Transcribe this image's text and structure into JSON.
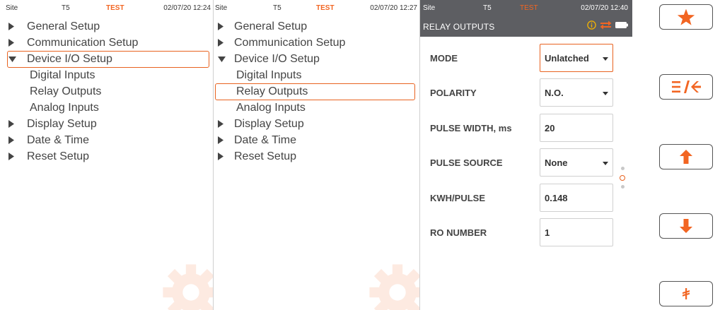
{
  "panel1": {
    "status": {
      "site": "Site",
      "meter": "T5",
      "mode": "TEST",
      "datetime": "02/07/20 12:24"
    },
    "menu": [
      {
        "label": "General Setup",
        "type": "collapsed"
      },
      {
        "label": "Communication Setup",
        "type": "collapsed"
      },
      {
        "label": "Device I/O Setup",
        "type": "expanded",
        "selected": true
      },
      {
        "label": "Digital Inputs",
        "type": "sub"
      },
      {
        "label": "Relay Outputs",
        "type": "sub"
      },
      {
        "label": "Analog Inputs",
        "type": "sub"
      },
      {
        "label": "Display Setup",
        "type": "collapsed"
      },
      {
        "label": "Date & Time",
        "type": "collapsed"
      },
      {
        "label": "Reset Setup",
        "type": "collapsed"
      }
    ]
  },
  "panel2": {
    "status": {
      "site": "Site",
      "meter": "T5",
      "mode": "TEST",
      "datetime": "02/07/20 12:27"
    },
    "menu": [
      {
        "label": "General Setup",
        "type": "collapsed"
      },
      {
        "label": "Communication Setup",
        "type": "collapsed"
      },
      {
        "label": "Device I/O Setup",
        "type": "expanded"
      },
      {
        "label": "Digital Inputs",
        "type": "sub"
      },
      {
        "label": "Relay Outputs",
        "type": "sub",
        "selected": true
      },
      {
        "label": "Analog Inputs",
        "type": "sub"
      },
      {
        "label": "Display Setup",
        "type": "collapsed"
      },
      {
        "label": "Date & Time",
        "type": "collapsed"
      },
      {
        "label": "Reset Setup",
        "type": "collapsed"
      }
    ]
  },
  "panel3": {
    "status": {
      "site": "Site",
      "meter": "T5",
      "mode": "TEST",
      "datetime": "02/07/20 12:40"
    },
    "title": "RELAY OUTPUTS",
    "header_icons": [
      "info-icon",
      "sync-arrows-icon",
      "battery-icon"
    ],
    "fields": {
      "mode": {
        "label": "MODE",
        "value": "Unlatched"
      },
      "polarity": {
        "label": "POLARITY",
        "value": "N.O."
      },
      "pulse_width": {
        "label": "PULSE WIDTH, ms",
        "value": "20"
      },
      "pulse_source": {
        "label": "PULSE SOURCE",
        "value": "None"
      },
      "kwh_pulse": {
        "label": "KWH/PULSE",
        "value": "0.148"
      },
      "ro_number": {
        "label": "RO NUMBER",
        "value": "1"
      }
    }
  },
  "side_buttons": [
    "star-icon",
    "menu-back-icon",
    "arrow-up-icon",
    "arrow-down-icon",
    "enter-icon"
  ],
  "colors": {
    "accent": "#e8621f",
    "header_bg": "#5d5e62",
    "text": "#444444"
  }
}
